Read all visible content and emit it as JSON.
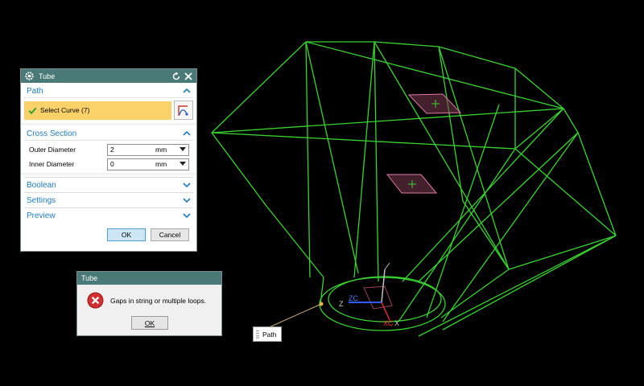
{
  "tube_dialog": {
    "title": "Tube",
    "path_section": {
      "label": "Path",
      "select_curve": "Select Curve (7)"
    },
    "cross_section": {
      "label": "Cross Section",
      "outer_label": "Outer Diameter",
      "outer_value": "2",
      "outer_unit": "mm",
      "inner_label": "Inner Diameter",
      "inner_value": "0",
      "inner_unit": "mm"
    },
    "boolean_label": "Boolean",
    "settings_label": "Settings",
    "preview_label": "Preview",
    "ok_label": "OK",
    "cancel_label": "Cancel"
  },
  "error_dialog": {
    "title": "Tube",
    "message": "Gaps in string or multiple loops.",
    "ok_label": "OK"
  },
  "path_label": "Path",
  "axes": {
    "z_label": "Z",
    "zc_label": "ZC",
    "xc_label": "XC",
    "x_label": "X"
  },
  "colors": {
    "viewport_bg": "#000000",
    "wireframe": "#39d42f",
    "selection_highlight": "#fbd26a",
    "title_bar": "#4a7a78",
    "section_text": "#1f7bbf"
  },
  "icons": [
    "gear-icon",
    "reset-icon",
    "close-icon",
    "check-icon",
    "curve-select-icon",
    "chevron-up-icon",
    "chevron-down-icon",
    "dropdown-icon",
    "error-icon",
    "grip-icon"
  ]
}
